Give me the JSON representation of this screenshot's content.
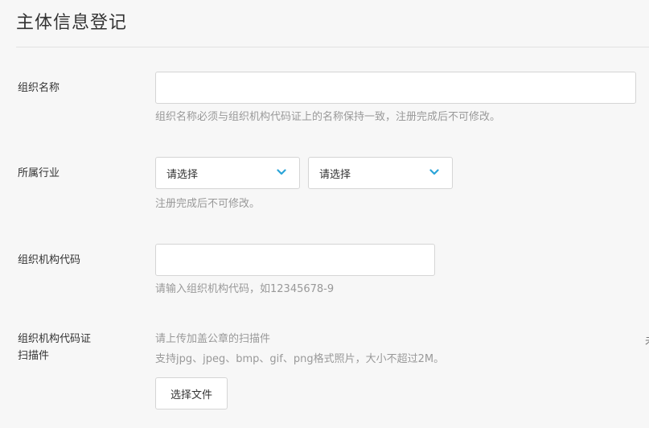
{
  "page": {
    "title": "主体信息登记"
  },
  "form": {
    "org_name": {
      "label": "组织名称",
      "value": "",
      "hint": "组织名称必须与组织机构代码证上的名称保持一致，注册完成后不可修改。"
    },
    "industry": {
      "label": "所属行业",
      "select1": "请选择",
      "select2": "请选择",
      "hint": "注册完成后不可修改。"
    },
    "org_code": {
      "label": "组织机构代码",
      "value": "",
      "hint": "请输入组织机构代码，如12345678-9"
    },
    "scan": {
      "label_line1": "组织机构代码证",
      "label_line2": "扫描件",
      "hint1": "请上传加盖公章的扫描件",
      "hint2": "支持jpg、jpeg、bmp、gif、png格式照片，大小不超过2M。",
      "button": "选择文件",
      "edge_text": "未"
    }
  },
  "colors": {
    "accent": "#2ba4d8",
    "hint": "#999999",
    "border": "#d5d5d5"
  },
  "icons": {
    "dropdown": "chevron-down-icon"
  }
}
